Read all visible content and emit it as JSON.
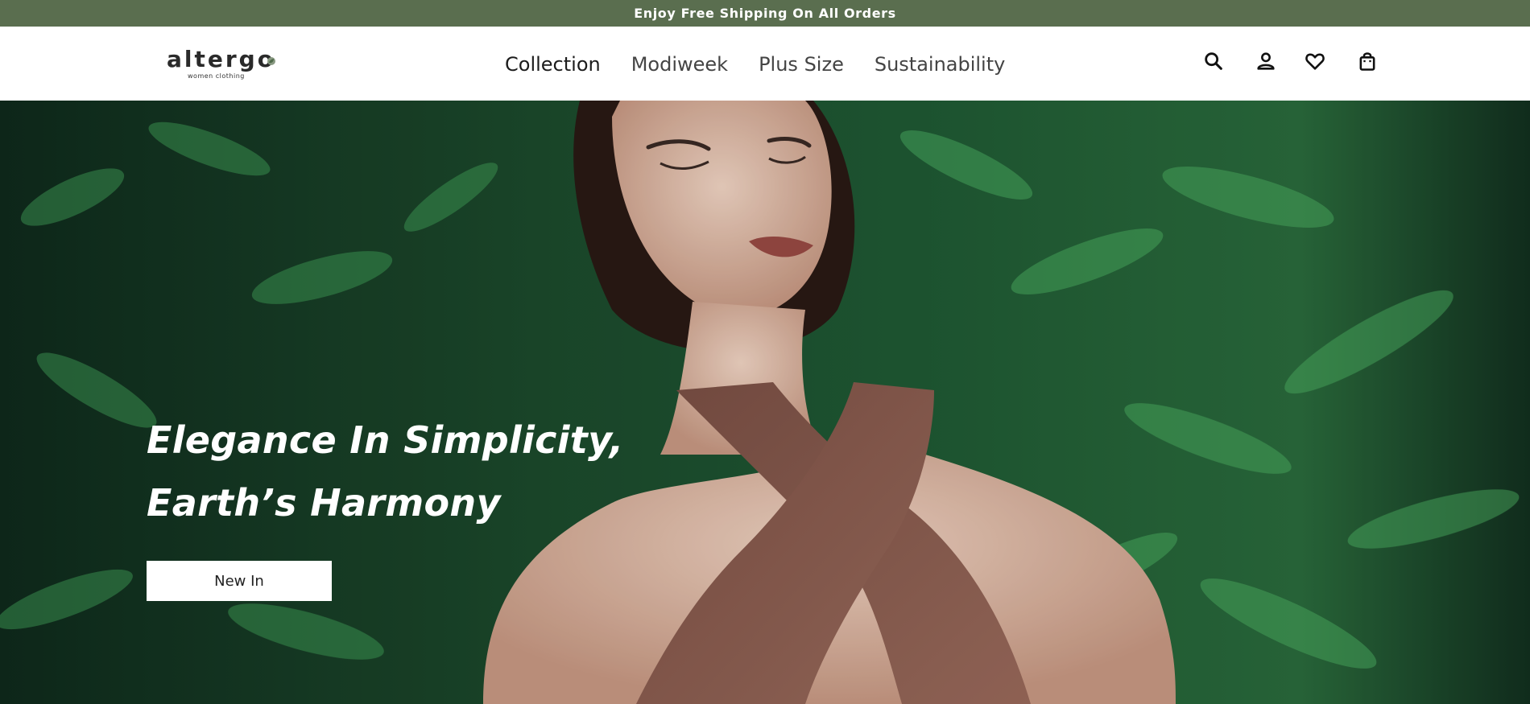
{
  "announcement": {
    "text": "Enjoy Free Shipping On All Orders",
    "background": "#5a6e4f"
  },
  "brand": {
    "name": "altergo",
    "tagline": "women clothing",
    "leaf_icon": "leaf-icon"
  },
  "nav": {
    "items": [
      {
        "label": "Collection",
        "active": true
      },
      {
        "label": "Modiweek",
        "active": false
      },
      {
        "label": "Plus Size",
        "active": false
      },
      {
        "label": "Sustainability",
        "active": false
      }
    ]
  },
  "header_icons": [
    "search-icon",
    "user-icon",
    "heart-icon",
    "shopping-bag-icon"
  ],
  "hero": {
    "headline_line1": "Elegance In Simplicity,",
    "headline_line2": "Earth’s Harmony",
    "cta_label": "New In",
    "image": "woman in brown halter top among green fern leaves"
  },
  "colors": {
    "accent_green": "#5a6e4f",
    "foliage": "#2f7a44",
    "top_fabric": "#8a5c4f"
  }
}
